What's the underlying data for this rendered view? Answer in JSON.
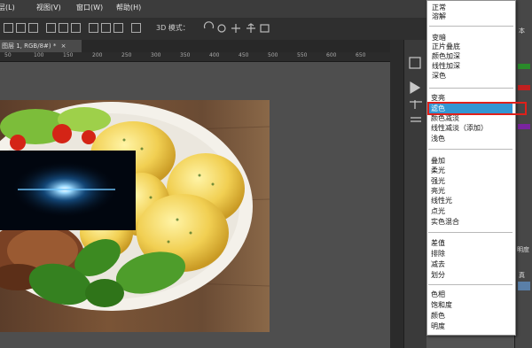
{
  "menubar": {
    "items": [
      {
        "label": "层(L)"
      },
      {
        "label": "视图(V)"
      },
      {
        "label": "窗口(W)"
      },
      {
        "label": "帮助(H)"
      }
    ]
  },
  "options_bar": {
    "mode_3d_label": "3D 模式："
  },
  "document": {
    "tab_title": "图层 1, RGB/8#) *",
    "close_glyph": "×"
  },
  "ruler": {
    "numbers": [
      "50",
      "100",
      "150",
      "200",
      "250",
      "300",
      "350",
      "400",
      "450",
      "500",
      "550",
      "600",
      "650"
    ]
  },
  "right_panel": {
    "text_labels": [
      "本",
      "明度",
      "真"
    ]
  },
  "blend_modes": {
    "selected": "滤色",
    "groups": [
      [
        "正常",
        "溶解"
      ],
      [
        "变暗",
        "正片叠底",
        "颜色加深",
        "线性加深",
        "深色"
      ],
      [
        "变亮",
        "滤色",
        "颜色减淡",
        "线性减淡（添加）",
        "浅色"
      ],
      [
        "叠加",
        "柔光",
        "强光",
        "亮光",
        "线性光",
        "点光",
        "实色混合"
      ],
      [
        "差值",
        "排除",
        "减去",
        "划分"
      ],
      [
        "色相",
        "饱和度",
        "颜色",
        "明度"
      ]
    ]
  },
  "colors": {
    "highlight": "#3396d3",
    "selection_outline": "#e0201a"
  }
}
